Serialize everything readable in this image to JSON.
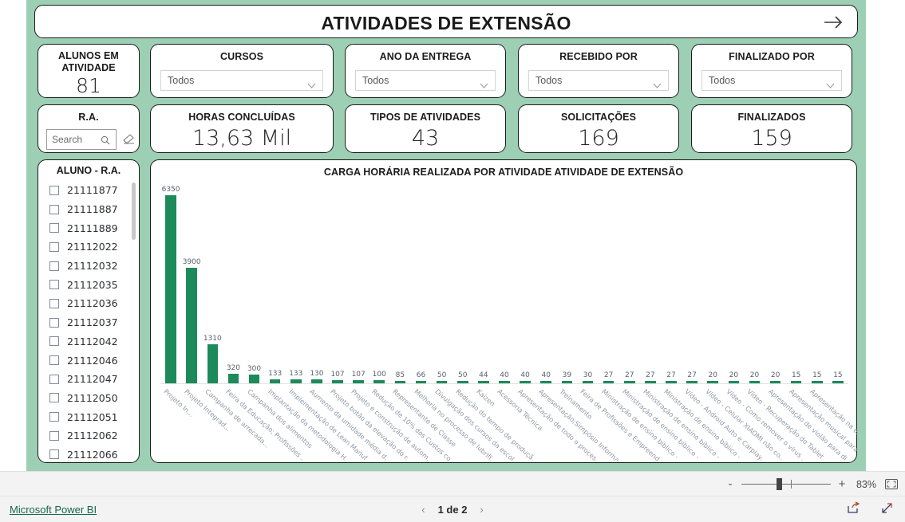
{
  "report": {
    "title": "ATIVIDADES DE EXTENSÃO",
    "arrow_icon": "arrow-right-icon",
    "background_color": "#9ccfb3",
    "accent_color": "#1d8a5b"
  },
  "kpis": {
    "alunos": {
      "label": "ALUNOS EM ATIVIDADE",
      "value": "81"
    },
    "horas": {
      "label": "HORAS CONCLUÍDAS",
      "value": "13,63 Mil"
    },
    "tipos": {
      "label": "TIPOS DE ATIVIDADES",
      "value": "43"
    },
    "solicitacoes": {
      "label": "SOLICITAÇÕES",
      "value": "169"
    },
    "finalizados": {
      "label": "FINALIZADOS",
      "value": "159"
    }
  },
  "slicers": [
    {
      "label": "CURSOS",
      "value": "Todos",
      "icon": "chevron-down-icon"
    },
    {
      "label": "ANO DA ENTREGA",
      "value": "Todos",
      "icon": "chevron-down-icon"
    },
    {
      "label": "RECEBIDO POR",
      "value": "Todos",
      "icon": "chevron-down-icon"
    },
    {
      "label": "FINALIZADO POR",
      "value": "Todos",
      "icon": "chevron-down-icon"
    }
  ],
  "ra_slicer": {
    "label": "R.A.",
    "placeholder": "Search",
    "search_icon": "search-icon",
    "clear_icon": "eraser-icon"
  },
  "aluno_list": {
    "header": "ALUNO - R.A.",
    "items": [
      "21111877",
      "21111887",
      "21111889",
      "21112022",
      "21112032",
      "21112035",
      "21112036",
      "21112037",
      "21112042",
      "21112046",
      "21112047",
      "21112050",
      "21112051",
      "21112062",
      "21112066"
    ]
  },
  "chart_data": {
    "type": "bar",
    "title": "CARGA HORÁRIA REALIZADA POR ATIVIDADE ATIVIDADE DE EXTENSÃO",
    "xlabel": "",
    "ylabel": "",
    "ylim": [
      0,
      6350
    ],
    "grid": false,
    "legend": false,
    "bar_color": "#1d8a5b",
    "categories": [
      "Projeto In...",
      "Projeto Integrad...",
      "Campanha de arrecada...",
      "Feira da Educação; Profissões ...",
      "Campanha dos alimentos",
      "Implantação da metodologia H...",
      "Implementação de Lean Manuf...",
      "Aumento da umidade média d...",
      "Projeto botão da elevação do r...",
      "Projeto e construção de autom...",
      "Redução de 10% dos Custos co...",
      "Representante de Classe",
      "Melhoria no processo de lubrifi...",
      "Divulgação dos cursos da escol...",
      "Redução do tempo de produçã...",
      "Kaizen",
      "Acessoria Técnica",
      "Apresentação de todo o proces...",
      "Apresentação;Simpósio Informa...",
      "Treinamento",
      "Feira de Profissões e Empreend...",
      "Ministração de ensino bíblico - ...",
      "Ministração de ensino bíblico - ...",
      "Ministração de ensino bíblico - ...",
      "Ministração de ensino bíblico - ...",
      "Vídeo - Android Auto e Carplay...",
      "Vídeo - Celular XIAOMI não co...",
      "Vídeo - Como remover o vírus ...",
      "Vídeo - Recuperação do Tablet ...",
      "Apresentação de violão para di...",
      "Apresentação musical para divu...",
      "Apresentação na empresa GKN ..."
    ],
    "values": [
      6350,
      3900,
      1310,
      320,
      300,
      133,
      133,
      130,
      107,
      107,
      100,
      85,
      66,
      50,
      50,
      44,
      40,
      40,
      40,
      39,
      30,
      27,
      27,
      27,
      27,
      27,
      20,
      20,
      20,
      20,
      15,
      15,
      15
    ]
  },
  "statusbar": {
    "zoom_out_label": "-",
    "zoom_in_label": "+",
    "zoom_percent": "83%",
    "fit_icon": "fit-to-page-icon"
  },
  "footer": {
    "brand": "Microsoft Power BI",
    "prev_icon": "chevron-left-icon",
    "page_text": "1 de 2",
    "next_icon": "chevron-right-icon",
    "share_icon": "share-icon",
    "fullscreen_icon": "fullscreen-icon"
  }
}
